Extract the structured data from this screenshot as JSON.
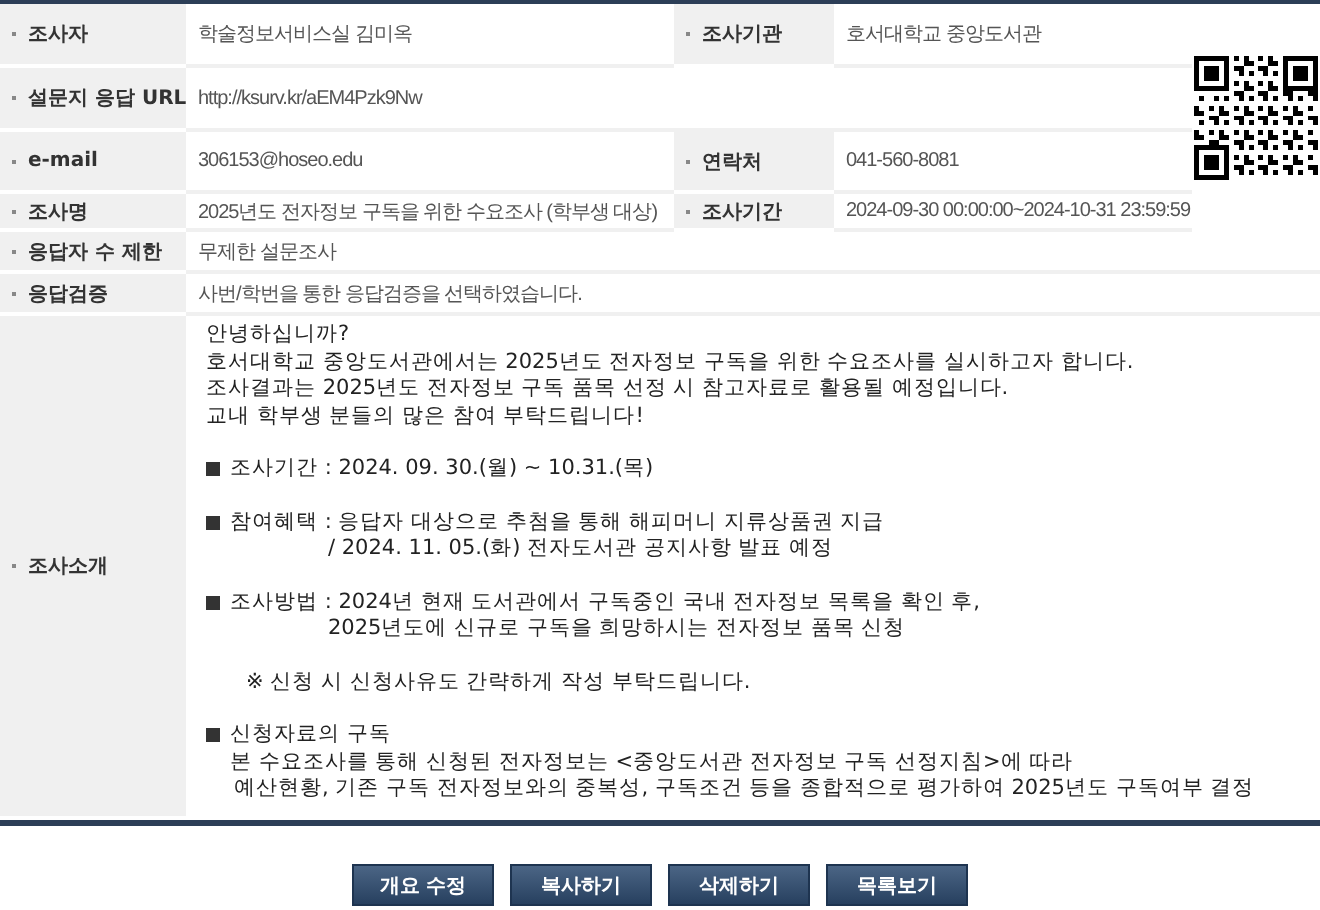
{
  "fields": [
    {
      "label": "조사자",
      "value": "학술정보서비스실 김미옥",
      "pair": {
        "label": "조사기관",
        "value": "호서대학교 중앙도서관"
      }
    },
    {
      "label": "설문지 응답 URL",
      "value": "http://ksurv.kr/aEM4Pzk9Nw"
    },
    {
      "label": "e-mail",
      "value": "306153@hoseo.edu",
      "pair": {
        "label": "연락처",
        "value": "041-560-8081"
      }
    },
    {
      "label": "조사명",
      "value": "2025년도 전자정보 구독을 위한 수요조사 (학부생 대상)",
      "pair": {
        "label": "조사기간",
        "value": "2024-09-30 00:00:00~2024-10-31 23:59:59"
      }
    },
    {
      "label": "응답자 수 제한",
      "value": "무제한 설문조사"
    },
    {
      "label": "응답검증",
      "value": "사번/학번을 통한 응답검증을 선택하였습니다."
    }
  ],
  "qr_code": {
    "kind": "qr"
  },
  "intro": {
    "label": "조사소개",
    "paragraphs": [
      [
        {
          "kind": "line",
          "text": "안녕하십니까?"
        },
        {
          "kind": "line",
          "text": "호서대학교 중앙도서관에서는 2025년도 전자정보 구독을 위한 수요조사를 실시하고자 합니다."
        },
        {
          "kind": "line",
          "text": "조사결과는 2025년도 전자정보 구독 품목 선정 시 참고자료로 활용될 예정입니다."
        },
        {
          "kind": "line",
          "text": "교내 학부생 분들의 많은 참여 부탁드립니다!"
        }
      ],
      [
        {
          "kind": "bullet",
          "text": "조사기간 : 2024. 09. 30.(월) ~ 10.31.(목)"
        }
      ],
      [
        {
          "kind": "bullet",
          "text": "참여혜택 : 응답자 대상으로 추첨을 통해 해피머니 지류상품권 지급"
        },
        {
          "kind": "hang",
          "text": "/ 2024. 11. 05.(화) 전자도서관 공지사항 발표 예정"
        }
      ],
      [
        {
          "kind": "bullet",
          "text": "조사방법 : 2024년 현재 도서관에서 구독중인 국내 전자정보 목록을 확인 후,"
        },
        {
          "kind": "hang",
          "text": "2025년도에 신규로 구독을 희망하시는 전자정보 품목 신청"
        }
      ],
      [
        {
          "kind": "note",
          "text": "※ 신청 시 신청사유도 간략하게 작성 부탁드립니다."
        }
      ],
      [
        {
          "kind": "bullet",
          "text": "신청자료의 구독"
        },
        {
          "kind": "indent",
          "text": "본 수요조사를 통해 신청된 전자정보는 <중앙도서관 전자정보 구독 선정지침>에 따라"
        },
        {
          "kind": "indent2",
          "text": "예산현황, 기존 구독 전자정보와의 중복성, 구독조건 등을 종합적으로 평가하여 2025년도 구독여부 결정"
        }
      ]
    ]
  },
  "buttons": [
    "개요 수정",
    "복사하기",
    "삭제하기",
    "목록보기"
  ]
}
